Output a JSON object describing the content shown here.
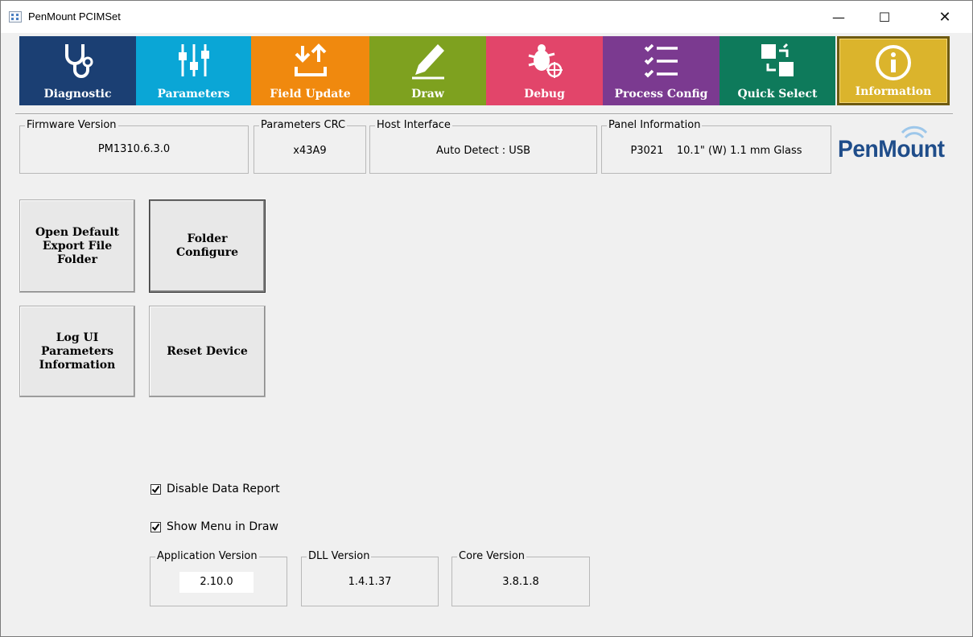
{
  "window": {
    "title": "PenMount PCIMSet",
    "min_glyph": "—",
    "max_glyph": "☐",
    "close_glyph": "✕"
  },
  "toolbar": {
    "items": [
      {
        "label": "Diagnostic",
        "icon": "stethoscope-icon",
        "color": "#1b3f73"
      },
      {
        "label": "Parameters",
        "icon": "sliders-icon",
        "color": "#0aa6d6"
      },
      {
        "label": "Field Update",
        "icon": "upload-icon",
        "color": "#f0890e"
      },
      {
        "label": "Draw",
        "icon": "pencil-icon",
        "color": "#7ea11f"
      },
      {
        "label": "Debug",
        "icon": "bug-icon",
        "color": "#e2456a"
      },
      {
        "label": "Process Config",
        "icon": "checklist-icon",
        "color": "#7b3a90"
      },
      {
        "label": "Quick Select",
        "icon": "swap-icon",
        "color": "#0e7a5b"
      },
      {
        "label": "Information",
        "icon": "info-icon",
        "color": "#dbb42c",
        "active": true
      }
    ]
  },
  "info": {
    "firmware_label": "Firmware Version",
    "firmware_value": "PM1310.6.3.0",
    "crc_label": "Parameters CRC",
    "crc_value": "x43A9",
    "host_label": "Host Interface",
    "host_value": "Auto Detect : USB",
    "panel_label": "Panel Information",
    "panel_value": "P3021    10.1\" (W) 1.1 mm Glass"
  },
  "logo_text": "PenMount",
  "buttons": {
    "open_default": "Open Default\nExport File\nFolder",
    "folder_configure": "Folder\nConfigure",
    "log_ui": "Log UI\nParameters\nInformation",
    "reset_device": "Reset Device"
  },
  "options": {
    "disable_data_report": {
      "label": "Disable Data Report",
      "checked": true
    },
    "show_menu_in_draw": {
      "label": "Show Menu in Draw",
      "checked": true
    }
  },
  "versions": {
    "app_label": "Application Version",
    "app_value": "2.10.0",
    "dll_label": "DLL Version",
    "dll_value": "1.4.1.37",
    "core_label": "Core Version",
    "core_value": "3.8.1.8"
  }
}
